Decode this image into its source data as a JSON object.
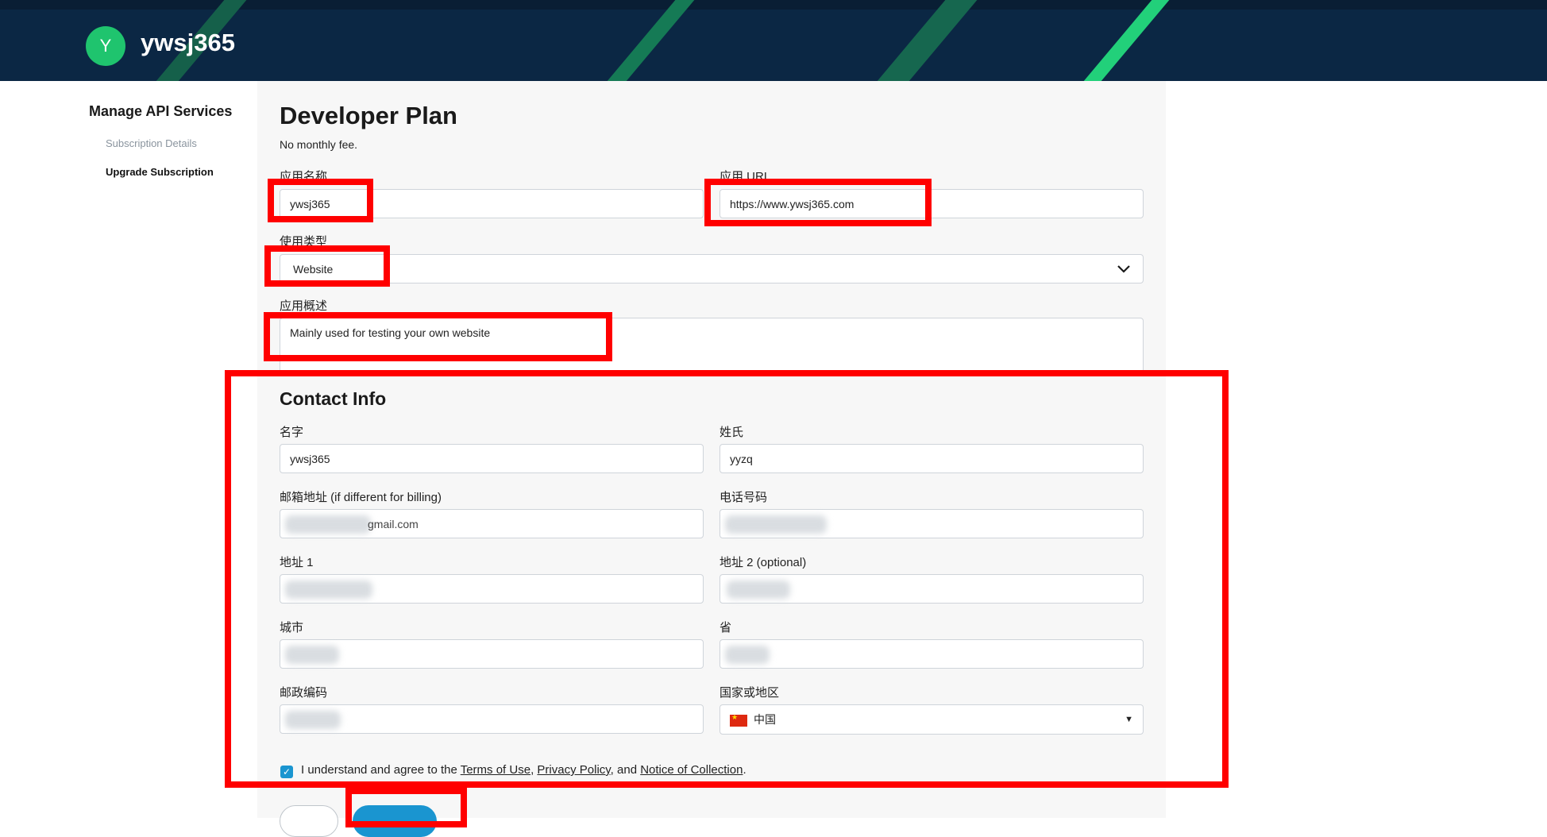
{
  "header": {
    "avatar_letter": "Y",
    "brand": "ywsj365"
  },
  "sidebar": {
    "title": "Manage API Services",
    "items": [
      {
        "label": "Subscription Details",
        "active": false
      },
      {
        "label": "Upgrade Subscription",
        "active": true
      }
    ]
  },
  "plan": {
    "title": "Developer Plan",
    "subtitle": "No monthly fee."
  },
  "app_form": {
    "app_name": {
      "label": "应用名称",
      "value": "ywsj365"
    },
    "app_url": {
      "label": "应用 URL",
      "value": "https://www.ywsj365.com"
    },
    "usage_type": {
      "label": "使用类型",
      "value": "Website"
    },
    "description": {
      "label": "应用概述",
      "value": "Mainly used for testing your own website"
    }
  },
  "contact": {
    "title": "Contact Info",
    "first_name": {
      "label": "名字",
      "value": "ywsj365"
    },
    "last_name": {
      "label": "姓氏",
      "value": "yyzq"
    },
    "email": {
      "label": "邮箱地址 (if different for billing)",
      "value": "gmail.com"
    },
    "phone": {
      "label": "电话号码",
      "value": ""
    },
    "address1": {
      "label": "地址 1",
      "value": ""
    },
    "address2": {
      "label": "地址 2 (optional)",
      "value": ""
    },
    "city": {
      "label": "城市",
      "value": ""
    },
    "province": {
      "label": "省",
      "value": ""
    },
    "postal": {
      "label": "邮政编码",
      "value": ""
    },
    "country": {
      "label": "国家或地区",
      "value": "中国"
    }
  },
  "agreement": {
    "prefix": "I understand and agree to the ",
    "terms": "Terms of Use",
    "sep1": ", ",
    "privacy": "Privacy Policy",
    "sep2": ", and ",
    "notice": "Notice of Collection",
    "suffix": ".",
    "checked": true
  },
  "colors": {
    "header_bg": "#0b2744",
    "accent_green": "#1fc46e",
    "primary_blue": "#1a95d0",
    "annotation_red": "#ff0000"
  },
  "icons": [
    "chevron-down-icon",
    "caret-down-icon",
    "china-flag-icon",
    "check-icon"
  ]
}
